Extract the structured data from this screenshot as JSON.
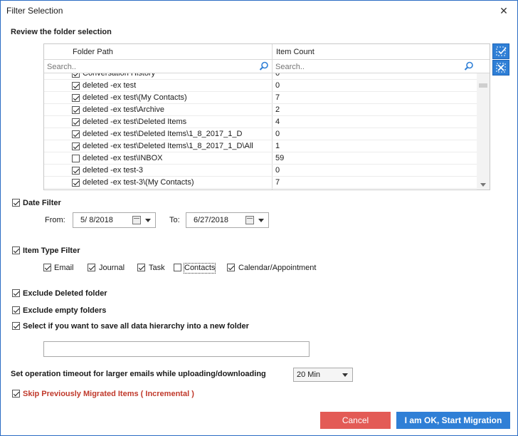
{
  "window": {
    "title": "Filter Selection",
    "close_glyph": "✕"
  },
  "review": {
    "label": "Review the folder selection",
    "columns": {
      "folder_path": "Folder Path",
      "item_count": "Item Count"
    },
    "search_placeholder": "Search..",
    "rows": [
      {
        "checked": true,
        "path": "Conversation History",
        "count": "0"
      },
      {
        "checked": true,
        "path": "deleted -ex test",
        "count": "0"
      },
      {
        "checked": true,
        "path": "deleted -ex test\\(My Contacts)",
        "count": "7"
      },
      {
        "checked": true,
        "path": "deleted -ex test\\Archive",
        "count": "2"
      },
      {
        "checked": true,
        "path": "deleted -ex test\\Deleted Items",
        "count": "4"
      },
      {
        "checked": true,
        "path": "deleted -ex test\\Deleted Items\\1_8_2017_1_D",
        "count": "0"
      },
      {
        "checked": true,
        "path": "deleted -ex test\\Deleted Items\\1_8_2017_1_D\\All",
        "count": "1"
      },
      {
        "checked": false,
        "path": "deleted -ex test\\INBOX",
        "count": "59"
      },
      {
        "checked": true,
        "path": "deleted -ex test-3",
        "count": "0"
      },
      {
        "checked": true,
        "path": "deleted -ex test-3\\(My Contacts)",
        "count": "7"
      }
    ]
  },
  "date_filter": {
    "label": "Date Filter",
    "checked": true,
    "from_label": "From:",
    "from_value": "5/ 8/2018",
    "to_label": "To:",
    "to_value": "6/27/2018"
  },
  "item_type_filter": {
    "label": "Item Type Filter",
    "checked": true,
    "types": [
      {
        "label": "Email",
        "checked": true
      },
      {
        "label": "Journal",
        "checked": true
      },
      {
        "label": "Task",
        "checked": true
      },
      {
        "label": "Contacts",
        "checked": false
      },
      {
        "label": "Calendar/Appointment",
        "checked": true
      }
    ]
  },
  "options": {
    "exclude_deleted": {
      "label": "Exclude Deleted folder",
      "checked": true
    },
    "exclude_empty": {
      "label": "Exclude empty folders",
      "checked": true
    },
    "save_hierarchy": {
      "label": "Select if you want to save all data hierarchy into a new folder",
      "checked": true,
      "value": ""
    }
  },
  "timeout": {
    "label": "Set operation timeout for larger emails while uploading/downloading",
    "value": "20 Min"
  },
  "incremental": {
    "label": "Skip Previously Migrated Items ( Incremental )",
    "checked": true
  },
  "buttons": {
    "cancel": "Cancel",
    "start": "I am OK, Start Migration"
  },
  "colors": {
    "accent": "#2f7fd6",
    "cancel": "#e35b56",
    "incremental_text": "#c0392b"
  }
}
